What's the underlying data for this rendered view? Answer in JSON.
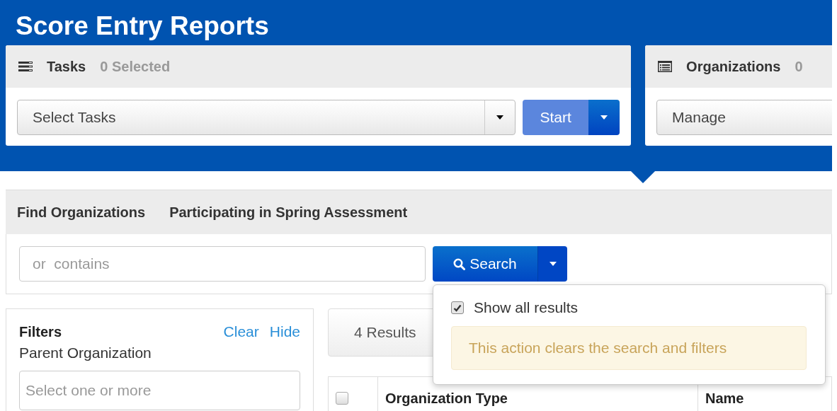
{
  "page_title": "Score Entry Reports",
  "tasks_panel": {
    "title": "Tasks",
    "count": "0 Selected",
    "select": {
      "value": "Select Tasks"
    },
    "start_button": "Start"
  },
  "organizations_panel": {
    "title": "Organizations",
    "count": "0",
    "select": {
      "value": "Manage"
    }
  },
  "find_bar": {
    "title": "Find Organizations",
    "subtitle": "Participating in Spring Assessment"
  },
  "search": {
    "placeholder": "or  contains",
    "button": "Search"
  },
  "search_menu": {
    "show_all": {
      "label": "Show all results",
      "checked": true
    },
    "warning": "This action clears the search and filters"
  },
  "filters": {
    "title": "Filters",
    "links": [
      "Clear",
      "Hide"
    ],
    "field_label": "Parent Organization",
    "field": {
      "placeholder": "Select one or more"
    }
  },
  "results": {
    "count": "4 Results",
    "select_all_checked": false,
    "columns": [
      {
        "label": "Organization Type"
      },
      {
        "label": "Name"
      }
    ]
  }
}
